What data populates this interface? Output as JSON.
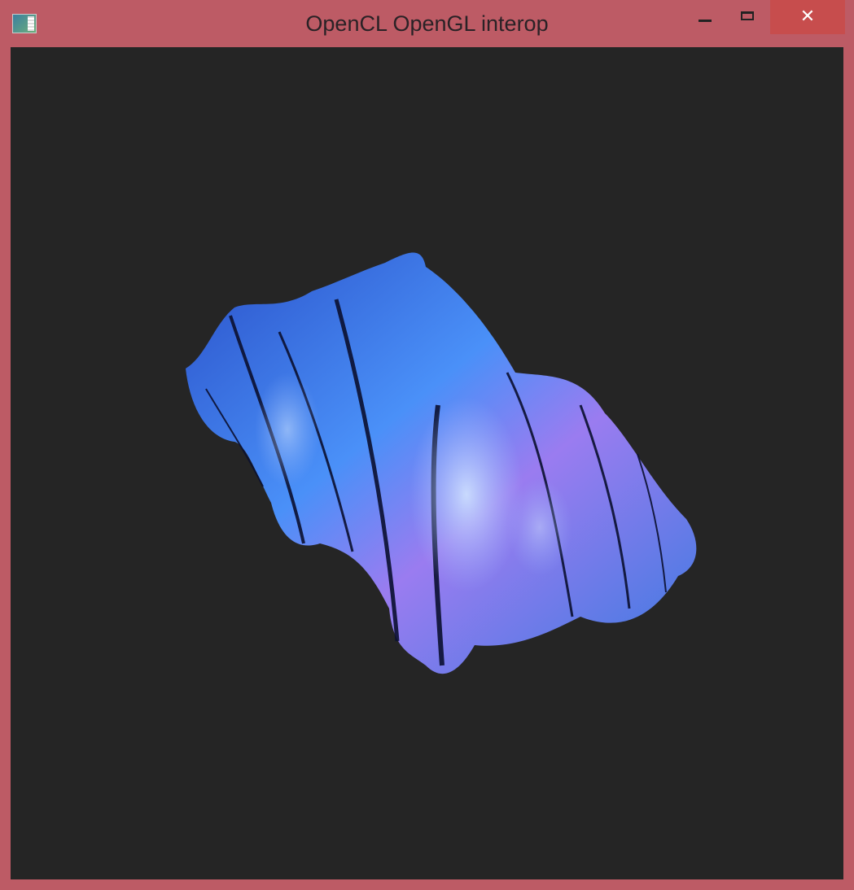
{
  "window": {
    "title": "OpenCL OpenGL interop",
    "icon": "application-icon",
    "controls": {
      "minimize": "minimize-icon",
      "maximize": "maximize-icon",
      "close": "close-icon",
      "close_glyph": "✕"
    }
  },
  "colors": {
    "frame": "#bd5b65",
    "close_button": "#c74d4d",
    "canvas_background": "#252525",
    "surface_primary": "#3c82f0",
    "surface_highlight": "#a8c8ff",
    "surface_accent": "#9a6ef0"
  }
}
